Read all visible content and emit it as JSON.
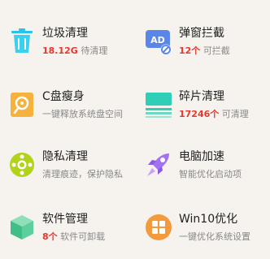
{
  "tiles": [
    {
      "title": "垃圾清理",
      "highlight": "18.12G",
      "rest": "待清理",
      "icon": "trash-icon"
    },
    {
      "title": "弹窗拦截",
      "highlight": "12个",
      "rest": "可拦截",
      "icon": "ad-block-icon"
    },
    {
      "title": "C盘瘦身",
      "highlight": "",
      "rest": "一键释放系统盘空间",
      "icon": "disk-slim-icon"
    },
    {
      "title": "碎片清理",
      "highlight": "17246个",
      "rest": "可清理",
      "icon": "fragment-icon"
    },
    {
      "title": "隐私清理",
      "highlight": "",
      "rest": "清理痕迹，保护隐私",
      "icon": "privacy-icon"
    },
    {
      "title": "电脑加速",
      "highlight": "",
      "rest": "智能优化启动项",
      "icon": "rocket-icon"
    },
    {
      "title": "软件管理",
      "highlight": "8个",
      "rest": "软件可卸载",
      "icon": "cube-icon"
    },
    {
      "title": "Win10优化",
      "highlight": "",
      "rest": "一键优化系统设置",
      "icon": "windows-icon"
    }
  ],
  "colors": {
    "accent_red": "#e8372c",
    "text_gray": "#888888"
  }
}
